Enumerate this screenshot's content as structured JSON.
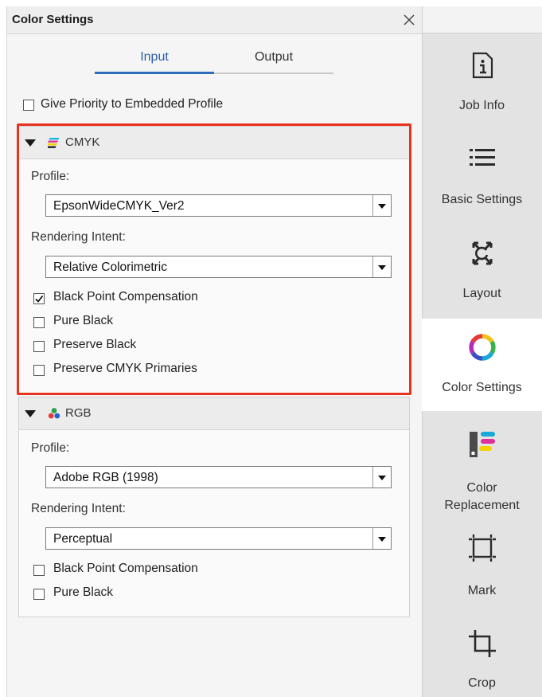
{
  "panel": {
    "title": "Color Settings"
  },
  "tabs": {
    "input": "Input",
    "output": "Output",
    "active": "Input"
  },
  "embedded_priority": {
    "label": "Give Priority to Embedded Profile",
    "checked": false
  },
  "cmyk": {
    "title": "CMYK",
    "profile_label": "Profile:",
    "profile_value": "EpsonWideCMYK_Ver2",
    "intent_label": "Rendering Intent:",
    "intent_value": "Relative Colorimetric",
    "options": [
      {
        "label": "Black Point Compensation",
        "checked": true
      },
      {
        "label": "Pure Black",
        "checked": false
      },
      {
        "label": "Preserve Black",
        "checked": false
      },
      {
        "label": "Preserve CMYK Primaries",
        "checked": false
      }
    ]
  },
  "rgb": {
    "title": "RGB",
    "profile_label": "Profile:",
    "profile_value": "Adobe RGB (1998)",
    "intent_label": "Rendering Intent:",
    "intent_value": "Perceptual",
    "options": [
      {
        "label": "Black Point Compensation",
        "checked": false
      },
      {
        "label": "Pure Black",
        "checked": false
      }
    ]
  },
  "sidebar": {
    "items": [
      {
        "label": "Job Info",
        "icon": "info-icon"
      },
      {
        "label": "Basic Settings",
        "icon": "list-icon"
      },
      {
        "label": "Layout",
        "icon": "layout-icon"
      },
      {
        "label": "Color Settings",
        "icon": "color-wheel-icon",
        "active": true
      },
      {
        "label_line1": "Color",
        "label_line2": "Replacement",
        "icon": "color-replacement-icon"
      },
      {
        "label": "Mark",
        "icon": "mark-icon"
      },
      {
        "label": "Crop",
        "icon": "crop-icon"
      }
    ]
  },
  "colors": {
    "accent": "#2f6db8",
    "highlight": "#e8321e"
  }
}
